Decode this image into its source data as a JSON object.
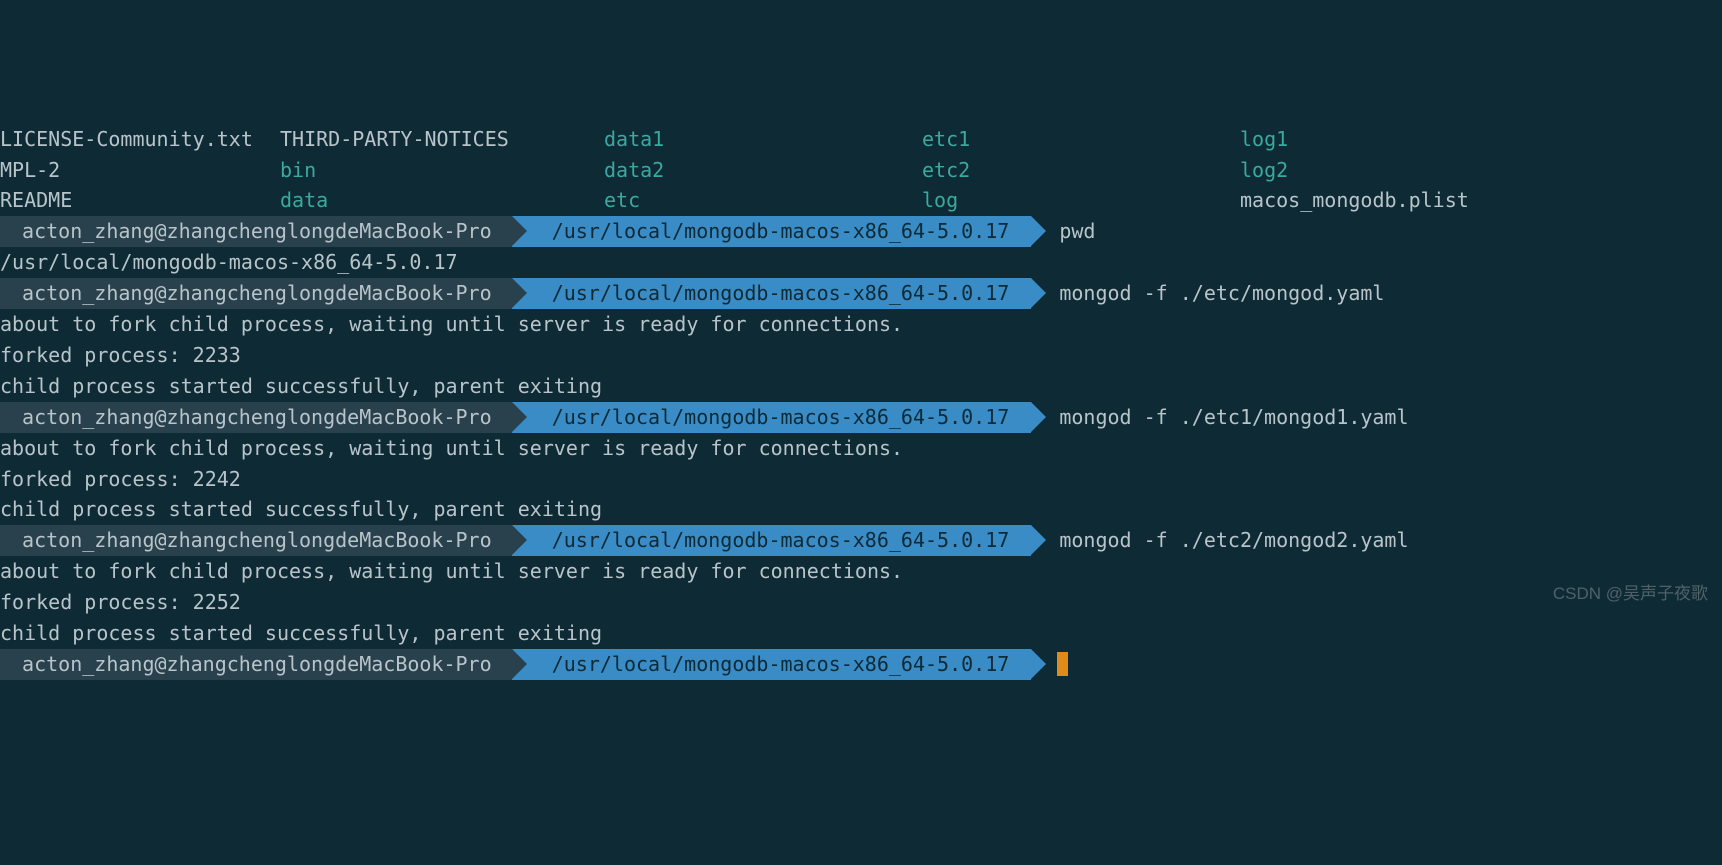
{
  "ls": {
    "rows": [
      [
        {
          "name": "LICENSE-Community.txt",
          "dir": false
        },
        {
          "name": "THIRD-PARTY-NOTICES",
          "dir": false
        },
        {
          "name": "data1",
          "dir": true
        },
        {
          "name": "etc1",
          "dir": true
        },
        {
          "name": "log1",
          "dir": true
        }
      ],
      [
        {
          "name": "MPL-2",
          "dir": false
        },
        {
          "name": "bin",
          "dir": true
        },
        {
          "name": "data2",
          "dir": true
        },
        {
          "name": "etc2",
          "dir": true
        },
        {
          "name": "log2",
          "dir": true
        }
      ],
      [
        {
          "name": "README",
          "dir": false
        },
        {
          "name": "data",
          "dir": true
        },
        {
          "name": "etc",
          "dir": true
        },
        {
          "name": "log",
          "dir": true
        },
        {
          "name": "macos_mongodb.plist",
          "dir": false
        }
      ]
    ]
  },
  "prompt": {
    "user": "acton_zhang@zhangchenglongdeMacBook-Pro",
    "path": "/usr/local/mongodb-macos-x86_64-5.0.17"
  },
  "blocks": [
    {
      "cmd": "pwd",
      "out": [
        "/usr/local/mongodb-macos-x86_64-5.0.17"
      ]
    },
    {
      "cmd": "mongod -f ./etc/mongod.yaml",
      "out": [
        "about to fork child process, waiting until server is ready for connections.",
        "forked process: 2233",
        "child process started successfully, parent exiting"
      ]
    },
    {
      "cmd": "mongod -f ./etc1/mongod1.yaml",
      "out": [
        "about to fork child process, waiting until server is ready for connections.",
        "forked process: 2242",
        "child process started successfully, parent exiting"
      ]
    },
    {
      "cmd": "mongod -f ./etc2/mongod2.yaml",
      "out": [
        "about to fork child process, waiting until server is ready for connections.",
        "forked process: 2252",
        "child process started successfully, parent exiting"
      ]
    }
  ],
  "watermark": "CSDN @吴声子夜歌"
}
